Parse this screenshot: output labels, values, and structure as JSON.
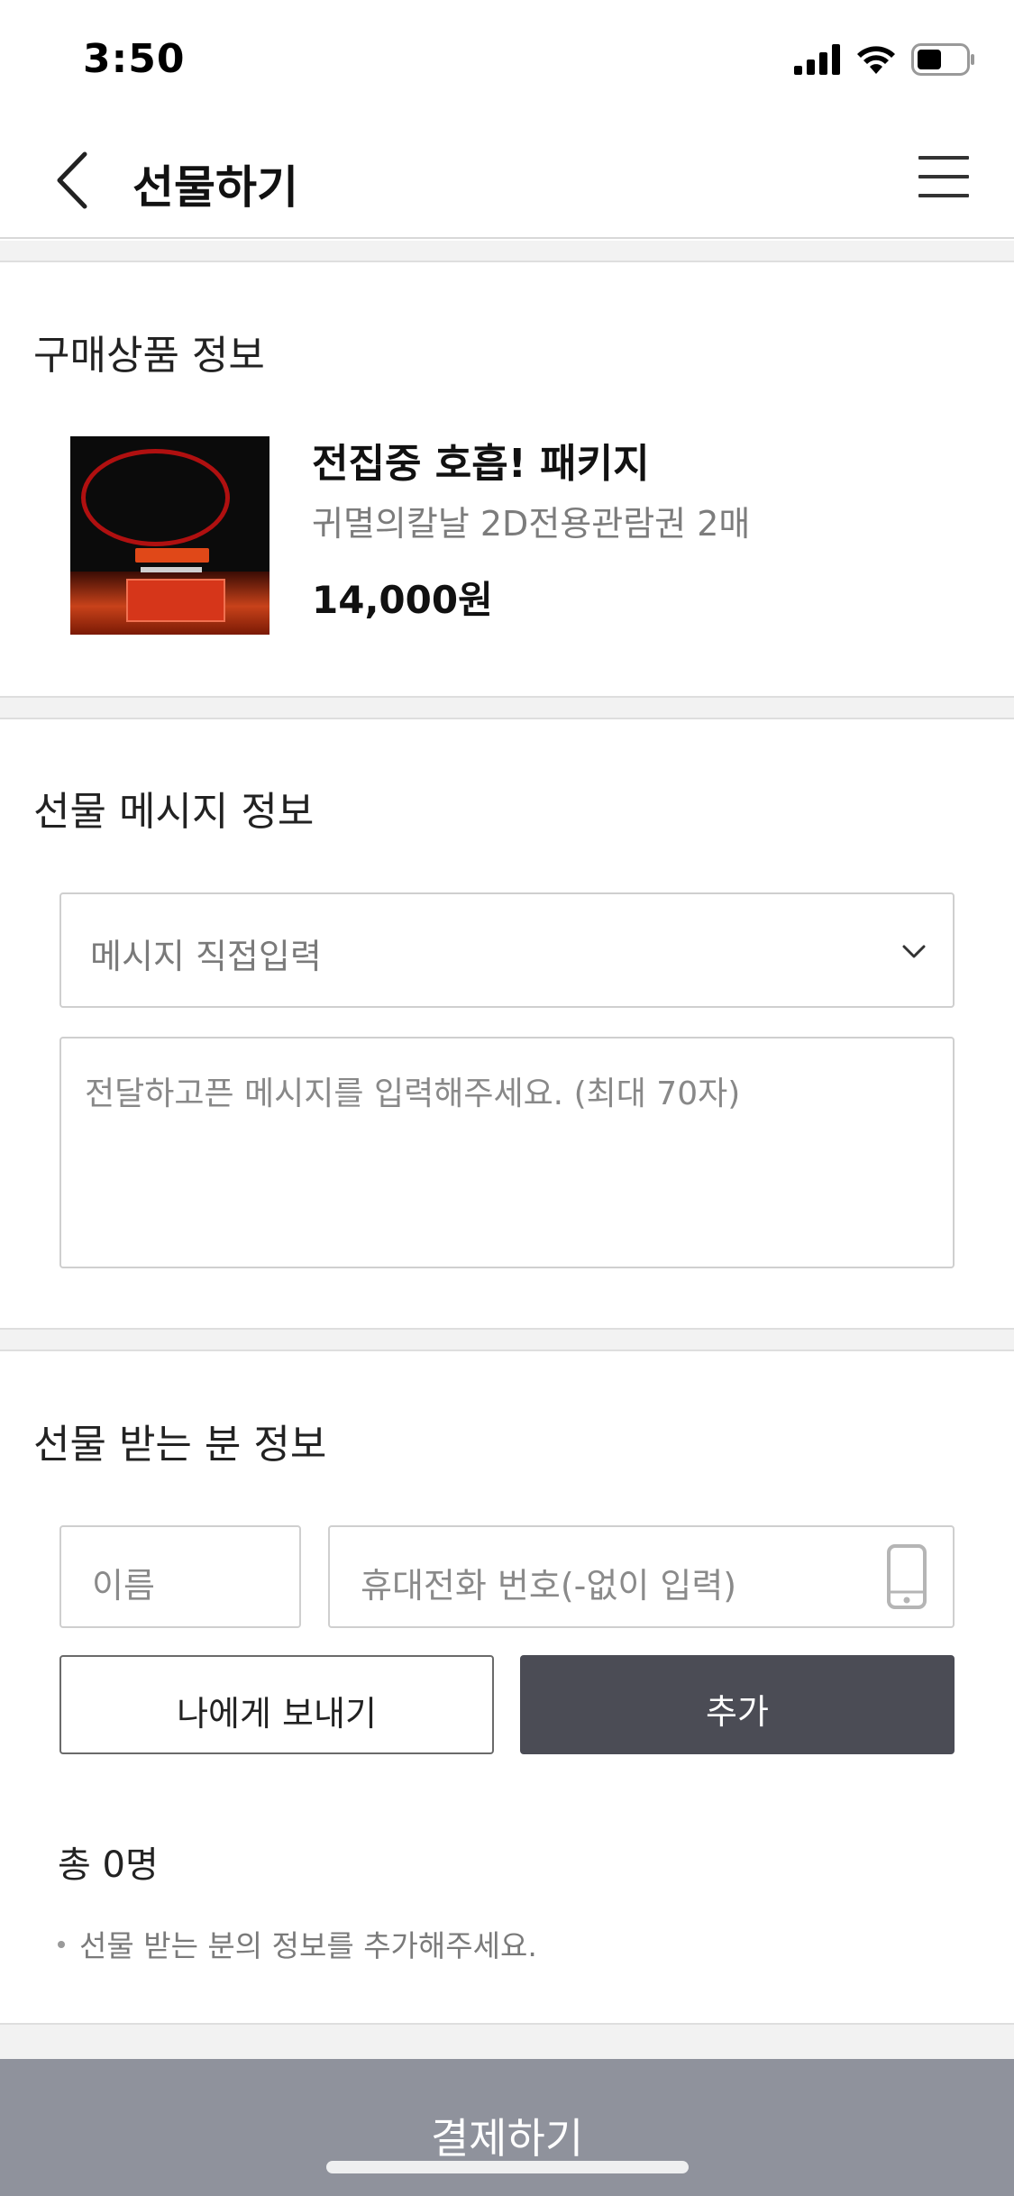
{
  "status_bar": {
    "time": "3:50"
  },
  "nav": {
    "title": "선물하기",
    "back_icon": "chevron-left-icon",
    "menu_icon": "hamburger-menu-icon"
  },
  "product_section": {
    "title": "구매상품 정보",
    "product": {
      "name": "전집중 호흡! 패키지",
      "description": "귀멸의칼날 2D전용관람권 2매",
      "price": "14,000원"
    }
  },
  "message_section": {
    "title": "선물 메시지 정보",
    "select_value": "메시지 직접입력",
    "textarea_placeholder": "전달하고픈 메시지를 입력해주세요. (최대 70자)"
  },
  "recipient_section": {
    "title": "선물 받는 분 정보",
    "name_placeholder": "이름",
    "phone_placeholder": "휴대전화 번호(-없이 입력)",
    "send_to_me_label": "나에게 보내기",
    "add_label": "추가",
    "total": "총 0명",
    "notice": "선물 받는 분의 정보를 추가해주세요."
  },
  "footer": {
    "pay_label": "결제하기"
  },
  "colors": {
    "add_button": "#4b4c55",
    "pay_bar": "#8f929c",
    "divider": "#f2f2f2"
  }
}
